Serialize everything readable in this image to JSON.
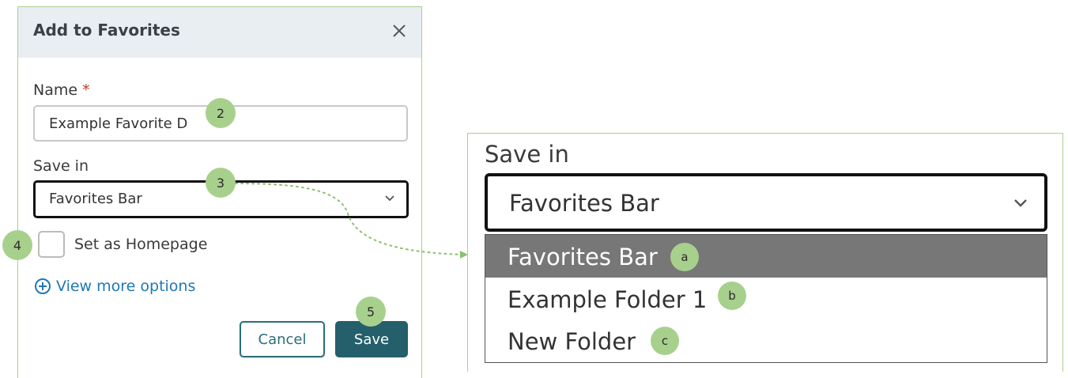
{
  "dialog": {
    "title": "Add to Favorites",
    "close_icon": "close-icon",
    "name_label": "Name",
    "required_marker": "*",
    "name_value": "Example Favorite D",
    "save_in_label": "Save in",
    "save_in_value": "Favorites Bar",
    "homepage_label": "Set as Homepage",
    "homepage_checked": false,
    "more_options_icon": "plus-circle-icon",
    "more_options_label": "View more options",
    "cancel_label": "Cancel",
    "save_label": "Save"
  },
  "steps": {
    "name": "2",
    "save_in": "3",
    "homepage": "4",
    "save": "5"
  },
  "zoom": {
    "label": "Save in",
    "selected_value": "Favorites Bar",
    "options": [
      {
        "label": "Favorites Bar",
        "marker": "a",
        "selected": true
      },
      {
        "label": "Example Folder 1",
        "marker": "b",
        "selected": false
      },
      {
        "label": "New Folder",
        "marker": "c",
        "selected": false
      }
    ]
  },
  "colors": {
    "accent_green": "#a8d08d",
    "primary_button": "#245f6b",
    "link_blue": "#1f78b4",
    "required_red": "#c0392b",
    "selected_option_bg": "#777777"
  }
}
